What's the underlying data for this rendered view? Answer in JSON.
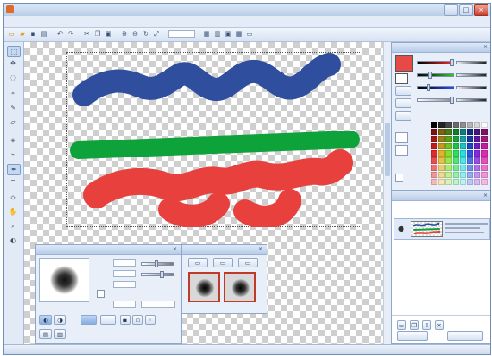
{
  "window": {
    "title": "",
    "controls": [
      "_",
      "□",
      "×"
    ]
  },
  "menu": [
    "",
    "",
    "",
    "",
    "",
    "",
    "",
    "",
    "",
    "",
    ""
  ],
  "toolbar": {
    "icons": [
      "new-icon",
      "open-icon",
      "save-icon",
      "print-icon",
      "undo-icon",
      "redo-icon",
      "cut-icon",
      "copy-icon",
      "paste-icon",
      "zoom-in-icon",
      "zoom-out-icon",
      "rotate-icon",
      "fit-icon",
      "grid-icon",
      "ruler-icon",
      "preview-icon"
    ],
    "zoom_value": ""
  },
  "tools": [
    "select",
    "move",
    "lasso",
    "wand",
    "brush",
    "eraser",
    "fill",
    "eyedropper",
    "pen",
    "text",
    "shape",
    "hand",
    "zoom",
    "color"
  ],
  "brush_panel": {
    "title": "",
    "labels": [
      "",
      "",
      ""
    ],
    "buttons": [
      "",
      ""
    ]
  },
  "preset_panel": {
    "title": ""
  },
  "color_panel": {
    "title": "",
    "primary_color": "#e64a47",
    "secondary_color": "#ffffff"
  },
  "layer_panel": {
    "title": "",
    "buttons": [
      "",
      ""
    ]
  },
  "strokes": {
    "blue": "#2f4f9e",
    "green": "#0ea33a",
    "red": "#e8413d"
  },
  "status": [
    "",
    "",
    "",
    ""
  ]
}
